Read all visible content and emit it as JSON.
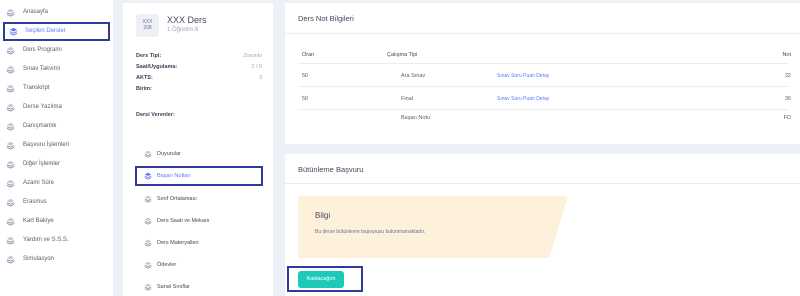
{
  "sidebar": {
    "items": [
      {
        "label": "Anasayfa",
        "icon": "layers-icon"
      },
      {
        "label": "Seçilen Dersler",
        "icon": "layers-icon"
      },
      {
        "label": "Ders Programı",
        "icon": "layers-icon"
      },
      {
        "label": "Sınav Takvimi",
        "icon": "layers-icon"
      },
      {
        "label": "Transkript",
        "icon": "layers-icon"
      },
      {
        "label": "Derse Yazılma",
        "icon": "layers-icon"
      },
      {
        "label": "Danışmanlık",
        "icon": "layers-icon"
      },
      {
        "label": "Başvuru İşlemleri",
        "icon": "layers-icon"
      },
      {
        "label": "Diğer İşlemler",
        "icon": "layers-icon"
      },
      {
        "label": "Azami Süre",
        "icon": "layers-icon"
      },
      {
        "label": "Erasmus",
        "icon": "layers-icon"
      },
      {
        "label": "Kart Bakiye",
        "icon": "layers-icon"
      },
      {
        "label": "Yardım ve S.S.S.",
        "icon": "layers-icon"
      },
      {
        "label": "Simulasyon",
        "icon": "layers-icon"
      }
    ]
  },
  "course": {
    "code_line1": "XXX",
    "code_line2": "208",
    "name": "XXX Ders",
    "lecturer": "1.Öğretim.6",
    "info": [
      {
        "key": "Ders Tipi:",
        "value": "Zorunlu"
      },
      {
        "key": "Saat/Uygulama:",
        "value": "2 / 0"
      },
      {
        "key": "AKTS:",
        "value": "3"
      },
      {
        "key": "Birim:",
        "value": ""
      }
    ],
    "teachers_label": "Dersi Verenler:",
    "menu": [
      {
        "label": "Duyurular",
        "icon": "layers-icon"
      },
      {
        "label": "Başarı Notları",
        "icon": "layers-icon"
      },
      {
        "label": "Sınıf Ortalaması",
        "icon": "layers-icon"
      },
      {
        "label": "Ders Saati ve Mekanı",
        "icon": "layers-icon"
      },
      {
        "label": "Ders Materyalleri",
        "icon": "layers-icon"
      },
      {
        "label": "Ödevler",
        "icon": "layers-icon"
      },
      {
        "label": "Sanal Sınıflar",
        "icon": "layers-icon"
      }
    ]
  },
  "grades": {
    "title": "Ders Not Bilgileri",
    "headers": {
      "ratio": "Oran",
      "type": "Çalışma Tipi",
      "grade": "Not"
    },
    "rows": [
      {
        "ratio": "50",
        "type": "Ara Sınav",
        "link": "Sınav Soru Puan Detay",
        "grade": "32"
      },
      {
        "ratio": "50",
        "type": "Final",
        "link": "Sınav Soru Puan Detay",
        "grade": "36"
      },
      {
        "ratio": "",
        "type": "Başarı Notu",
        "link": "",
        "grade": "FD"
      }
    ]
  },
  "makeup": {
    "title": "Bütünleme Başvuru",
    "alert_title": "Bilgi",
    "alert_text": "Bu derse bütünleme başvurusu bulunmamaktadır.",
    "button_label": "Katılacağım"
  },
  "colors": {
    "accent": "#5d78ff",
    "button": "#1dc9b7",
    "alert_bg": "#fdf1dc",
    "highlight_border": "#2e3a9e"
  }
}
